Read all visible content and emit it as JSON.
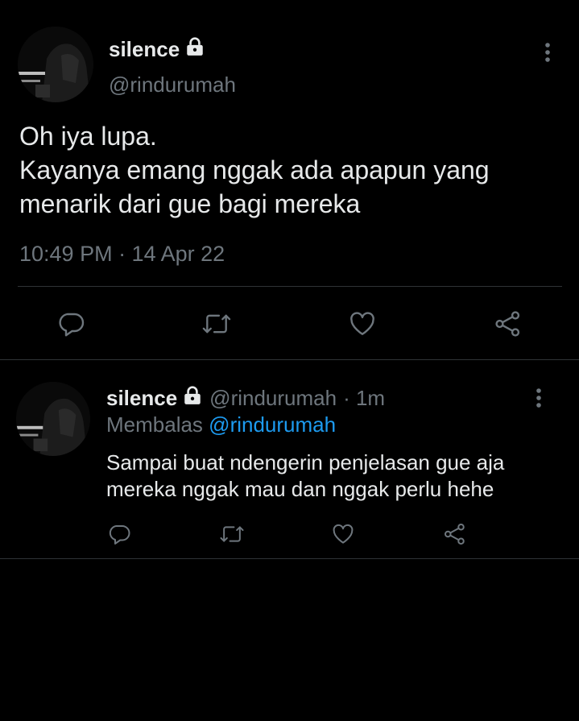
{
  "main_tweet": {
    "author": {
      "display_name": "silence",
      "handle": "@rindurumah",
      "locked": true
    },
    "text_lines": [
      "Oh iya lupa.",
      "Kayanya emang nggak ada apapun yang",
      "menarik dari gue bagi mereka"
    ],
    "timestamp": "10:49 PM · 14 Apr 22",
    "actions": [
      "reply-icon",
      "retweet-icon",
      "like-icon",
      "share-icon"
    ]
  },
  "reply_tweet": {
    "author": {
      "display_name": "silence",
      "handle": "@rindurumah",
      "age": "· 1m",
      "locked": true
    },
    "replying_prefix": "Membalas",
    "replying_to": "@rindurumah",
    "text_lines": [
      "Sampai buat ndengerin penjelasan gue aja",
      "mereka nggak mau dan nggak perlu hehe"
    ],
    "actions": [
      "reply-icon",
      "retweet-icon",
      "like-icon",
      "share-icon"
    ]
  },
  "colors": {
    "background": "#000000",
    "text": "#e7e9ea",
    "muted": "#6e767d",
    "link": "#1d9bf0",
    "divider": "#2f3336"
  }
}
